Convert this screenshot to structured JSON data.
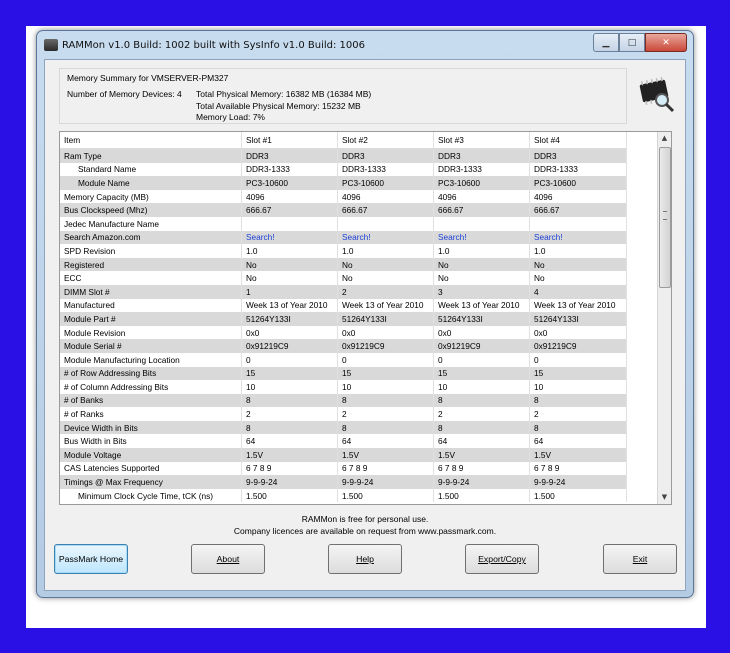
{
  "window": {
    "title": "RAMMon v1.0 Build: 1002 built with SysInfo v1.0 Build: 1006",
    "controls": {
      "minimize": "▁",
      "maximize": "□",
      "close": "✕"
    }
  },
  "summary": {
    "title": "Memory Summary for VMSERVER-PM327",
    "devices": "Number of Memory Devices: 4",
    "total_physical": "Total Physical Memory: 16382 MB (16384 MB)",
    "total_available": "Total Available Physical Memory: 15232 MB",
    "memory_load": "Memory Load: 7%"
  },
  "icons": {
    "app": "chip-icon",
    "summary_graphic": "chip-magnifier-icon"
  },
  "table": {
    "headers": [
      "Item",
      "Slot #1",
      "Slot #2",
      "Slot #3",
      "Slot #4"
    ],
    "rows": [
      {
        "label": "Ram Type",
        "values": [
          "DDR3",
          "DDR3",
          "DDR3",
          "DDR3"
        ],
        "shade": true
      },
      {
        "label": "Standard Name",
        "values": [
          "DDR3-1333",
          "DDR3-1333",
          "DDR3-1333",
          "DDR3-1333"
        ],
        "indent": true
      },
      {
        "label": "Module Name",
        "values": [
          "PC3-10600",
          "PC3-10600",
          "PC3-10600",
          "PC3-10600"
        ],
        "shade": true,
        "indent": true
      },
      {
        "label": "Memory Capacity (MB)",
        "values": [
          "4096",
          "4096",
          "4096",
          "4096"
        ]
      },
      {
        "label": "Bus Clockspeed (Mhz)",
        "values": [
          "666.67",
          "666.67",
          "666.67",
          "666.67"
        ],
        "shade": true
      },
      {
        "label": "Jedec Manufacture Name",
        "values": [
          "",
          "",
          "",
          ""
        ]
      },
      {
        "label": "Search Amazon.com",
        "values": [
          "Search!",
          "Search!",
          "Search!",
          "Search!"
        ],
        "shade": true,
        "link": true
      },
      {
        "label": "SPD Revision",
        "values": [
          "1.0",
          "1.0",
          "1.0",
          "1.0"
        ]
      },
      {
        "label": "Registered",
        "values": [
          "No",
          "No",
          "No",
          "No"
        ],
        "shade": true
      },
      {
        "label": "ECC",
        "values": [
          "No",
          "No",
          "No",
          "No"
        ]
      },
      {
        "label": "DIMM Slot #",
        "values": [
          "1",
          "2",
          "3",
          "4"
        ],
        "shade": true
      },
      {
        "label": "Manufactured",
        "values": [
          "Week 13 of Year 2010",
          "Week 13 of Year 2010",
          "Week 13 of Year 2010",
          "Week 13 of Year 2010"
        ]
      },
      {
        "label": "Module Part #",
        "values": [
          "51264Y133I",
          "51264Y133I",
          "51264Y133I",
          "51264Y133I"
        ],
        "shade": true
      },
      {
        "label": "Module Revision",
        "values": [
          "0x0",
          "0x0",
          "0x0",
          "0x0"
        ]
      },
      {
        "label": "Module Serial #",
        "values": [
          "0x91219C9",
          "0x91219C9",
          "0x91219C9",
          "0x91219C9"
        ],
        "shade": true
      },
      {
        "label": "Module Manufacturing Location",
        "values": [
          "0",
          "0",
          "0",
          "0"
        ]
      },
      {
        "label": "# of Row Addressing Bits",
        "values": [
          "15",
          "15",
          "15",
          "15"
        ],
        "shade": true
      },
      {
        "label": "# of Column Addressing Bits",
        "values": [
          "10",
          "10",
          "10",
          "10"
        ]
      },
      {
        "label": "# of Banks",
        "values": [
          "8",
          "8",
          "8",
          "8"
        ],
        "shade": true
      },
      {
        "label": "# of Ranks",
        "values": [
          "2",
          "2",
          "2",
          "2"
        ]
      },
      {
        "label": "Device Width in Bits",
        "values": [
          "8",
          "8",
          "8",
          "8"
        ],
        "shade": true
      },
      {
        "label": "Bus Width in Bits",
        "values": [
          "64",
          "64",
          "64",
          "64"
        ]
      },
      {
        "label": "Module Voltage",
        "values": [
          "1.5V",
          "1.5V",
          "1.5V",
          "1.5V"
        ],
        "shade": true
      },
      {
        "label": "CAS Latencies Supported",
        "values": [
          "6 7 8 9",
          "6 7 8 9",
          "6 7 8 9",
          "6 7 8 9"
        ]
      },
      {
        "label": "Timings @ Max Frequency",
        "values": [
          "9-9-9-24",
          "9-9-9-24",
          "9-9-9-24",
          "9-9-9-24"
        ],
        "shade": true
      },
      {
        "label": "Minimum Clock Cycle Time, tCK (ns)",
        "values": [
          "1.500",
          "1.500",
          "1.500",
          "1.500"
        ],
        "indent": true
      }
    ]
  },
  "footer": {
    "line1": "RAMMon is free for personal use.",
    "line2": "Company licences are available on request from www.passmark.com."
  },
  "buttons": {
    "passmark_home": "PassMark Home",
    "about": "About",
    "help": "Help",
    "export": "Export/Copy",
    "exit": "Exit"
  },
  "colors": {
    "link": "#1a3fd8",
    "shade": "#d9d9d9",
    "backdrop": "#2b10e6"
  }
}
